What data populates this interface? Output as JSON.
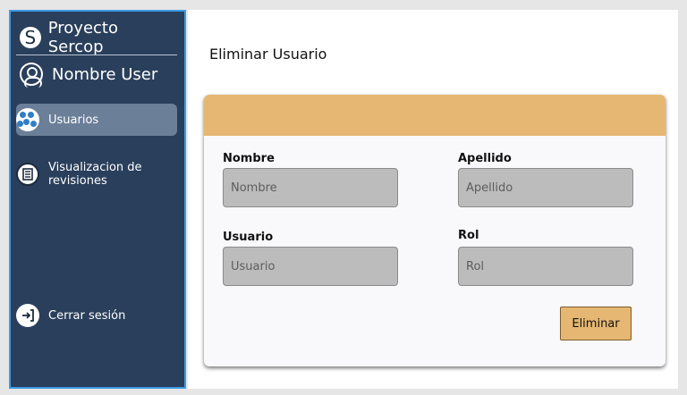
{
  "sidebar": {
    "brand_initial": "S",
    "brand_title": "Proyecto Sercop",
    "user_name": "Nombre User",
    "items": [
      {
        "label": "Usuarios",
        "icon": "users-icon",
        "active": true
      },
      {
        "label": "Visualizacion de revisiones",
        "icon": "document-icon",
        "active": false
      },
      {
        "label": "Cerrar sesión",
        "icon": "logout-icon",
        "active": false
      }
    ]
  },
  "main": {
    "title": "Eliminar Usuario",
    "form": {
      "nombre": {
        "label": "Nombre",
        "placeholder": "Nombre"
      },
      "apellido": {
        "label": "Apellido",
        "placeholder": "Apellido"
      },
      "usuario": {
        "label": "Usuario",
        "placeholder": "Usuario"
      },
      "rol": {
        "label": "Rol",
        "placeholder": "Rol"
      }
    },
    "delete_label": "Eliminar"
  },
  "colors": {
    "sidebar_bg": "#2a3f5b",
    "sidebar_border": "#3c9be6",
    "accent": "#e6b772",
    "active_item_bg": "#6c7f98"
  }
}
